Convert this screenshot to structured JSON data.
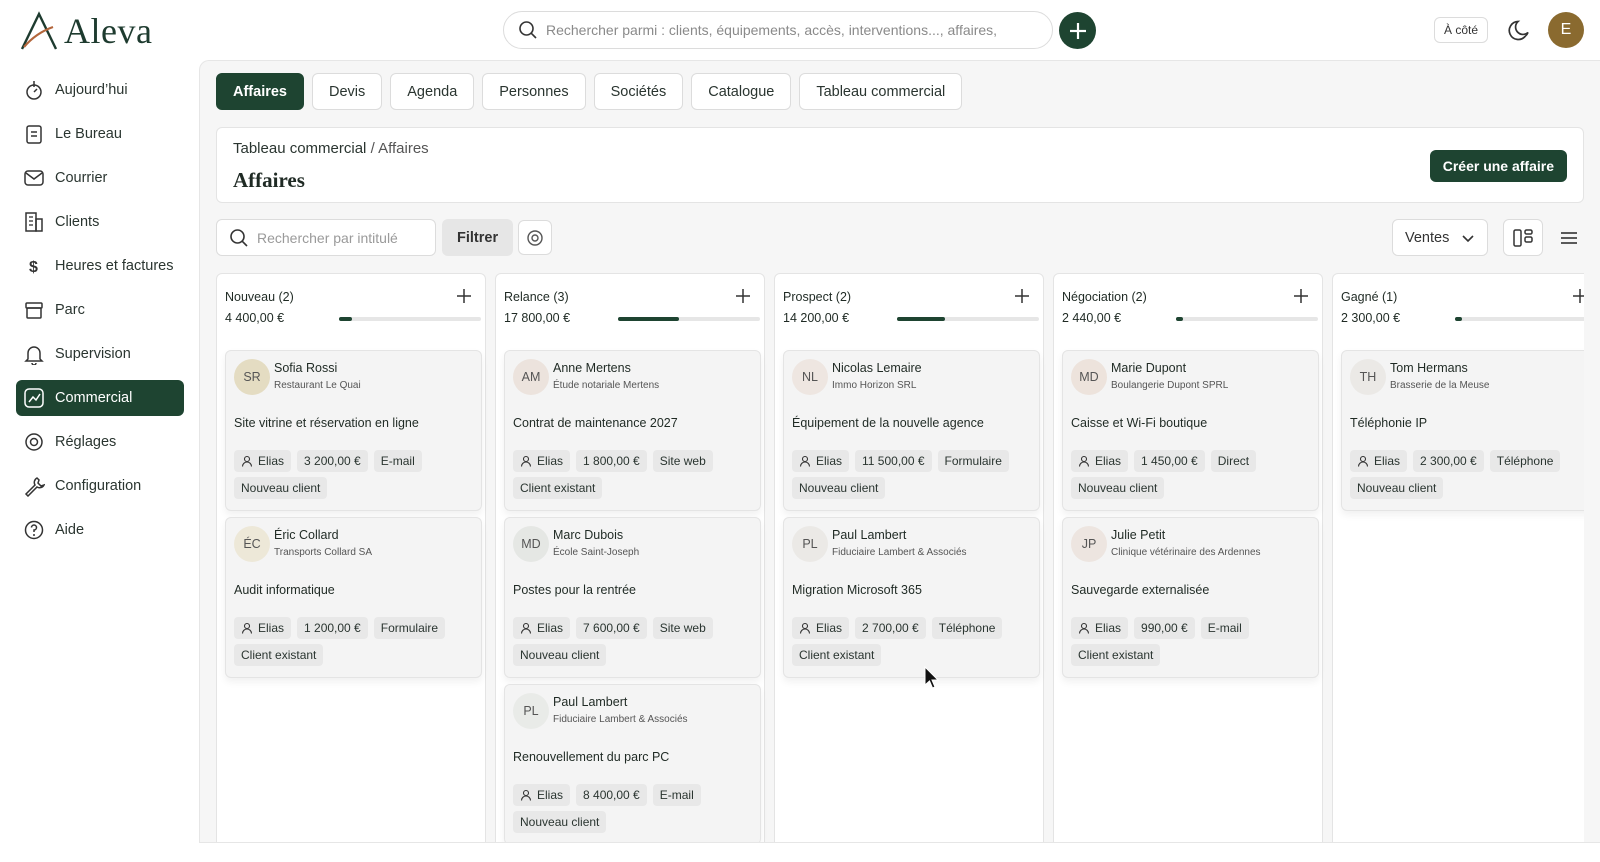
{
  "app": {
    "name": "Aleva"
  },
  "search": {
    "placeholder": "Rechercher parmi : clients, équipements, accès, interventions..., affaires,"
  },
  "header": {
    "a_cote": "À côté",
    "avatar_initial": "E"
  },
  "sidebar": {
    "items": [
      {
        "label": "Aujourd’hui",
        "icon": "today-icon"
      },
      {
        "label": "Le Bureau",
        "icon": "clipboard-icon"
      },
      {
        "label": "Courrier",
        "icon": "mail-icon"
      },
      {
        "label": "Clients",
        "icon": "building-icon"
      },
      {
        "label": "Heures et factures",
        "icon": "dollar-icon"
      },
      {
        "label": "Parc",
        "icon": "archive-icon"
      },
      {
        "label": "Supervision",
        "icon": "bell-icon"
      },
      {
        "label": "Commercial",
        "icon": "commercial-icon"
      },
      {
        "label": "Réglages",
        "icon": "settings-icon"
      },
      {
        "label": "Configuration",
        "icon": "wrench-icon"
      },
      {
        "label": "Aide",
        "icon": "help-icon"
      }
    ]
  },
  "tabs": [
    "Affaires",
    "Devis",
    "Agenda",
    "Personnes",
    "Sociétés",
    "Catalogue",
    "Tableau commercial"
  ],
  "breadcrumb": {
    "parent": "Tableau commercial",
    "sep": "/",
    "current": "Affaires"
  },
  "page": {
    "title": "Affaires",
    "create_label": "Créer une affaire"
  },
  "filters": {
    "search_placeholder": "Rechercher par intitulé",
    "filter_label": "Filtrer",
    "view_select": "Ventes"
  },
  "columns": [
    {
      "title": "Nouveau (2)",
      "amount": "4 400,00 €",
      "progress": 0.09,
      "deals": [
        {
          "initials": "SR",
          "name": "Sofia Rossi",
          "company": "Restaurant Le Quai",
          "title": "Site vitrine et réservation en ligne",
          "owner": "Elias",
          "amount": "3 200,00 €",
          "source": "E-mail",
          "status": "Nouveau client",
          "color": "#e4dcc2"
        },
        {
          "initials": "ÉC",
          "name": "Éric Collard",
          "company": "Transports Collard SA",
          "title": "Audit informatique",
          "owner": "Elias",
          "amount": "1 200,00 €",
          "source": "Formulaire",
          "status": "Client existant",
          "color": "#ede8d8"
        }
      ]
    },
    {
      "title": "Relance (3)",
      "amount": "17 800,00 €",
      "progress": 0.43,
      "deals": [
        {
          "initials": "AM",
          "name": "Anne Mertens",
          "company": "Étude notariale Mertens",
          "title": "Contrat de maintenance 2027",
          "owner": "Elias",
          "amount": "1 800,00 €",
          "source": "Site web",
          "status": "Client existant",
          "color": "#ece3dd"
        },
        {
          "initials": "MD",
          "name": "Marc Dubois",
          "company": "École Saint-Joseph",
          "title": "Postes pour la rentrée",
          "owner": "Elias",
          "amount": "7 600,00 €",
          "source": "Site web",
          "status": "Nouveau client",
          "color": "#e5e7e4"
        },
        {
          "initials": "PL",
          "name": "Paul Lambert",
          "company": "Fiduciaire Lambert & Associés",
          "title": "Renouvellement du parc PC",
          "owner": "Elias",
          "amount": "8 400,00 €",
          "source": "E-mail",
          "status": "Nouveau client",
          "color": "#e9ebe8"
        }
      ]
    },
    {
      "title": "Prospect (2)",
      "amount": "14 200,00 €",
      "progress": 0.34,
      "deals": [
        {
          "initials": "NL",
          "name": "Nicolas Lemaire",
          "company": "Immo Horizon SRL",
          "title": "Équipement de la nouvelle agence",
          "owner": "Elias",
          "amount": "11 500,00 €",
          "source": "Formulaire",
          "status": "Nouveau client",
          "color": "#eee6e1"
        },
        {
          "initials": "PL",
          "name": "Paul Lambert",
          "company": "Fiduciaire Lambert & Associés",
          "title": "Migration Microsoft 365",
          "owner": "Elias",
          "amount": "2 700,00 €",
          "source": "Téléphone",
          "status": "Client existant",
          "color": "#ebe9e6"
        }
      ]
    },
    {
      "title": "Négociation (2)",
      "amount": "2 440,00 €",
      "progress": 0.05,
      "deals": [
        {
          "initials": "MD",
          "name": "Marie Dupont",
          "company": "Boulangerie Dupont SPRL",
          "title": "Caisse et Wi-Fi boutique",
          "owner": "Elias",
          "amount": "1 450,00 €",
          "source": "Direct",
          "status": "Nouveau client",
          "color": "#ede3dc"
        },
        {
          "initials": "JP",
          "name": "Julie Petit",
          "company": "Clinique vétérinaire des Ardennes",
          "title": "Sauvegarde externalisée",
          "owner": "Elias",
          "amount": "990,00 €",
          "source": "E-mail",
          "status": "Client existant",
          "color": "#ede5e0"
        }
      ]
    },
    {
      "title": "Gagné (1)",
      "amount": "2 300,00 €",
      "progress": 0.05,
      "deals": [
        {
          "initials": "TH",
          "name": "Tom Hermans",
          "company": "Brasserie de la Meuse",
          "title": "Téléphonie IP",
          "owner": "Elias",
          "amount": "2 300,00 €",
          "source": "Téléphone",
          "status": "Nouveau client",
          "color": "#ebe9e6"
        }
      ]
    }
  ]
}
